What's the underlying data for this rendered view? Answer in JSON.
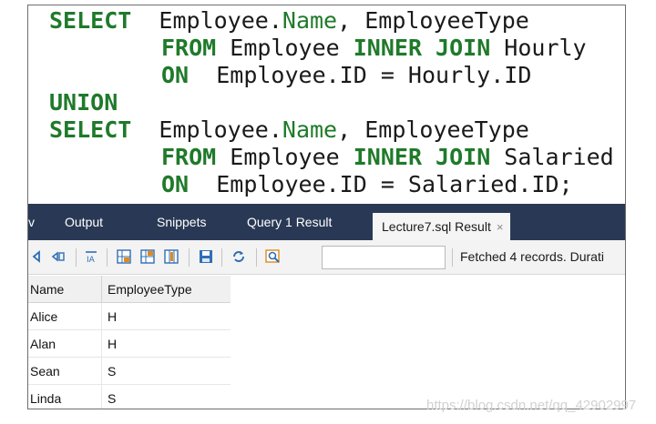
{
  "editor": {
    "lines": [
      {
        "kw": "SELECT",
        "gap": "  ",
        "parts": [
          "Employee.",
          "Name",
          ", EmployeeType"
        ]
      },
      {
        "kw": "FROM",
        "rest_a": " Employee ",
        "kw2": "INNER JOIN",
        "rest_b": " Hourly"
      },
      {
        "kw": "ON",
        "rest": "  Employee.ID = Hourly.ID"
      },
      {
        "kw": "UNION"
      },
      {
        "kw": "SELECT",
        "gap": "  ",
        "parts": [
          "Employee.",
          "Name",
          ", EmployeeType"
        ]
      },
      {
        "kw": "FROM",
        "rest_a": " Employee ",
        "kw2": "INNER JOIN",
        "rest_b": " Salaried"
      },
      {
        "kw": "ON",
        "rest": "  Employee.ID = Salaried.ID;"
      }
    ]
  },
  "tabs": {
    "partial": "v",
    "items": [
      "Output",
      "Snippets",
      "Query 1 Result",
      "Lecture7.sql Result"
    ],
    "close_glyph": "×"
  },
  "toolbar": {
    "search_value": "",
    "status": "Fetched 4 records. Durati"
  },
  "grid": {
    "columns": [
      "Name",
      "EmployeeType"
    ],
    "rows": [
      [
        "Alice",
        "H"
      ],
      [
        "Alan",
        "H"
      ],
      [
        "Sean",
        "S"
      ],
      [
        "Linda",
        "S"
      ]
    ]
  },
  "watermark": "https://blog.csdn.net/qq_42902997",
  "colors": {
    "keyword": "#1f7a2a",
    "tab_bar": "#293955",
    "icon_blue": "#2f6fb5",
    "icon_orange": "#e08a1e"
  }
}
